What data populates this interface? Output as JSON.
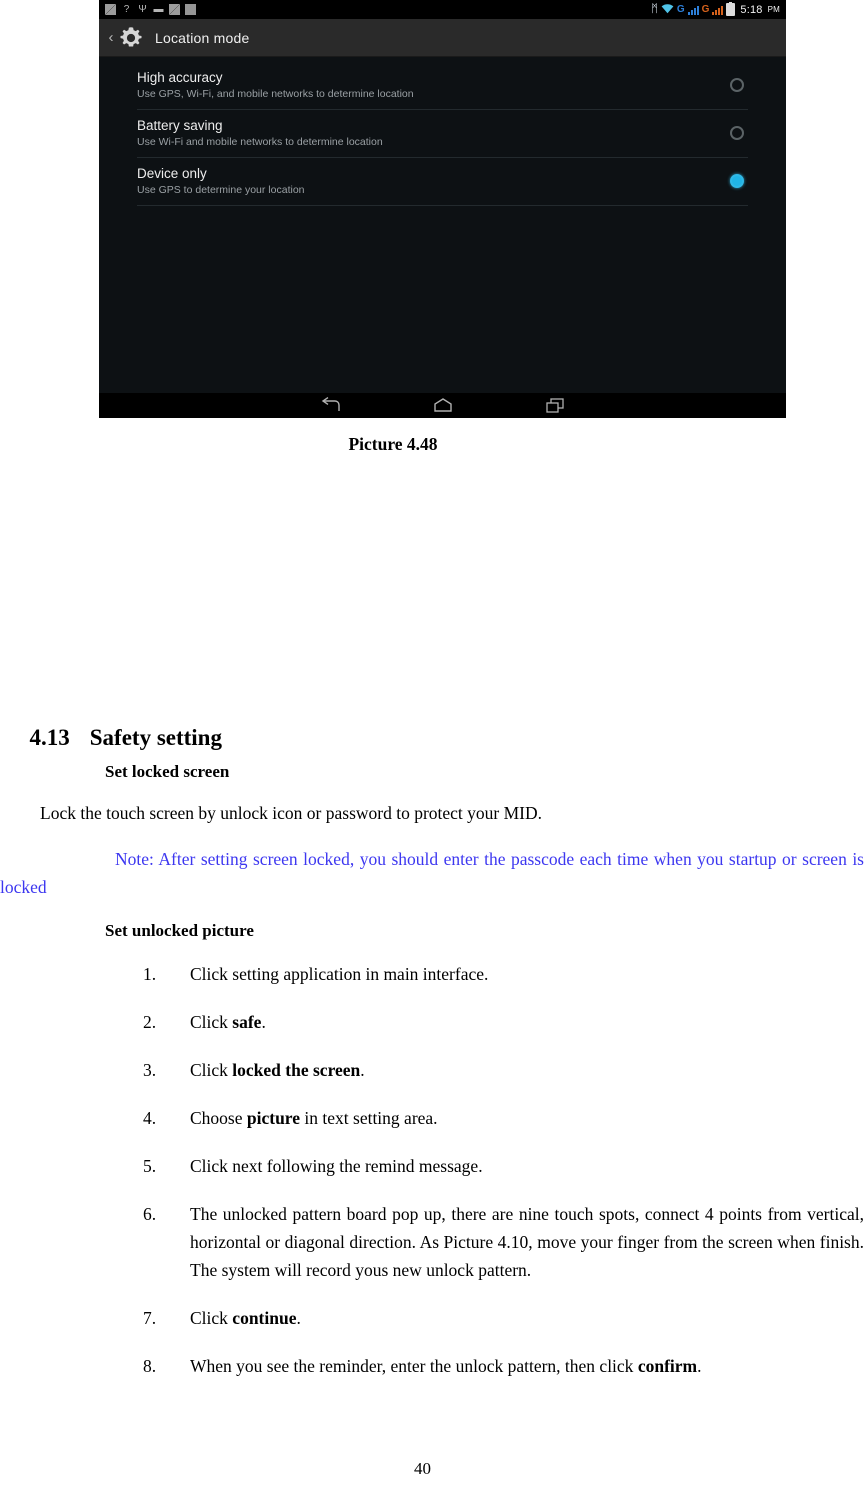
{
  "screenshot": {
    "status_bar": {
      "left_icons": [
        "screenshot-icon",
        "question-icon",
        "usb-icon",
        "lock-icon",
        "screenshot-icon",
        "square-icon"
      ],
      "right_icons": [
        "bluetooth-icon",
        "wifi-icon",
        "signal-g-blue-icon",
        "signal-g-orange-icon",
        "battery-icon"
      ],
      "bluetooth_glyph": "ᛗ",
      "wifi_glyph": "▲",
      "question_glyph": "?",
      "usb_glyph": "Ψ",
      "lock_glyph": "▬",
      "g_label_blue": "G",
      "g_label_orange": "G",
      "time": "5:18",
      "ampm": "PM"
    },
    "action_bar": {
      "back_glyph": "‹",
      "icon": "settings-gear-icon",
      "title": "Location mode"
    },
    "modes": [
      {
        "title": "High accuracy",
        "subtitle": "Use GPS, Wi-Fi, and mobile networks to determine location",
        "selected": false
      },
      {
        "title": "Battery saving",
        "subtitle": "Use Wi-Fi and mobile networks to determine location",
        "selected": false
      },
      {
        "title": "Device only",
        "subtitle": "Use GPS to determine your location",
        "selected": true
      }
    ],
    "nav_bar": {
      "items": [
        "back-nav-icon",
        "home-nav-icon",
        "recent-apps-nav-icon"
      ]
    },
    "accent_color": "#20b4e6",
    "background_color": "#0d1114"
  },
  "document": {
    "caption": "Picture 4.48",
    "heading": {
      "number": "4.13",
      "title": "Safety setting"
    },
    "subheading_1": "Set locked screen",
    "paragraph_1": "Lock the touch screen by unlock icon or password to protect your MID.",
    "note": "Note: After setting screen locked, you should enter the passcode each time when you startup or screen is locked",
    "note_color": "#3d37f0",
    "subheading_2": "Set unlocked picture",
    "steps": [
      {
        "marker": "1.",
        "pre": "Click setting application in main interface.",
        "bold": "",
        "post": ""
      },
      {
        "marker": "2.",
        "pre": "Click ",
        "bold": "safe",
        "post": "."
      },
      {
        "marker": "3.",
        "pre": "Click ",
        "bold": "locked the screen",
        "post": "."
      },
      {
        "marker": "4.",
        "pre": "Choose ",
        "bold": "picture",
        "post": " in text setting area."
      },
      {
        "marker": "5.",
        "pre": "Click next following the remind message.",
        "bold": "",
        "post": ""
      },
      {
        "marker": "6.",
        "pre": "The unlocked pattern board pop up, there are nine touch spots, connect 4 points from vertical, horizontal or diagonal direction. As Picture 4.10, move your finger from the screen when finish. The system will record yous new unlock pattern.",
        "bold": "",
        "post": ""
      },
      {
        "marker": "7.",
        "pre": "Click ",
        "bold": "continue",
        "post": "."
      },
      {
        "marker": "8.",
        "pre": "When you see the reminder, enter the unlock pattern, then click ",
        "bold": "confirm",
        "post": "."
      }
    ],
    "page_number": "40"
  }
}
